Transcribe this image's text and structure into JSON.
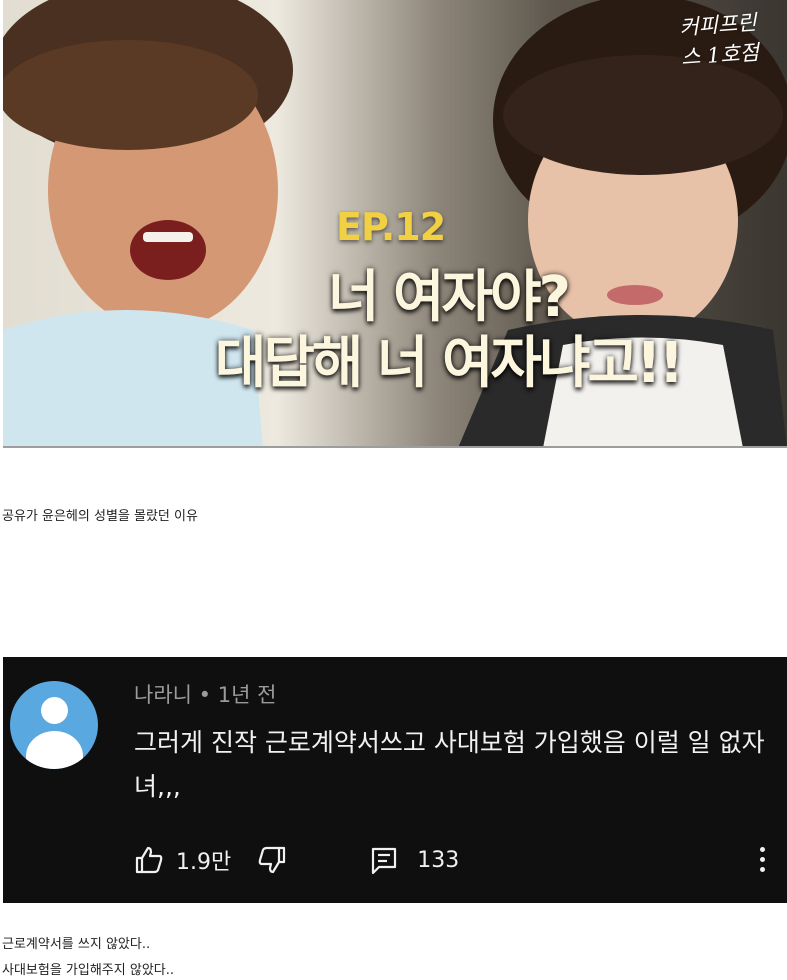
{
  "thumbnail": {
    "brand_mark": "커피프린스 1호점",
    "episode_label": "EP.12",
    "headline_lines": [
      "너 여자야?",
      "대답해 너 여자냐고!!"
    ]
  },
  "caption_top": "공유가 윤은헤의 성별을 몰랐던 이유",
  "comment": {
    "author": "나라니",
    "time": "1년 전",
    "meta_separator": "•",
    "text": "그러게 진작 근로계약서쓰고 사대보험 가입했음 이럴 일 없자녀,,,",
    "like_count": "1.9만",
    "reply_count": "133",
    "icons": [
      "avatar-icon",
      "thumbs-up-icon",
      "thumbs-down-icon",
      "reply-icon",
      "more-vert-icon"
    ]
  },
  "caption_bottom": [
    "근로계약서를 쓰지 않았다..",
    "사대보험을 가입해주지 않았다.."
  ],
  "colors": {
    "episode_label": "#f1d043",
    "comment_bg": "#0f0f0f",
    "avatar": "#5aa8e0"
  }
}
